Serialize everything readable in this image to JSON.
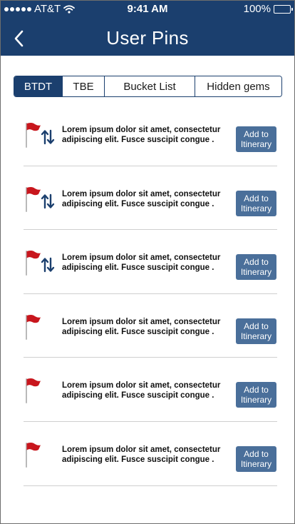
{
  "status_bar": {
    "carrier": "AT&T",
    "time": "9:41 AM",
    "battery": "100%",
    "battery_level": 1.0
  },
  "header": {
    "title": "User Pins",
    "back_icon": "chevron-left-icon"
  },
  "tabs": [
    {
      "label": "BTDT",
      "active": true
    },
    {
      "label": "TBE",
      "active": false
    },
    {
      "label": "Bucket List",
      "active": false
    },
    {
      "label": "Hidden gems",
      "active": false
    }
  ],
  "pins": [
    {
      "text": "Lorem ipsum dolor sit amet, consectetur adipiscing elit. Fusce suscipit congue .",
      "button": "Add to Itinerary",
      "has_sort": true,
      "flag_icon": "red-flag-icon",
      "sort_icon": "sort-arrows-icon"
    },
    {
      "text": "Lorem ipsum dolor sit amet, consectetur adipiscing elit. Fusce suscipit congue .",
      "button": "Add to Itinerary",
      "has_sort": true,
      "flag_icon": "red-flag-icon",
      "sort_icon": "sort-arrows-icon"
    },
    {
      "text": "Lorem ipsum dolor sit amet, consectetur adipiscing elit. Fusce suscipit congue .",
      "button": "Add to Itinerary",
      "has_sort": true,
      "flag_icon": "red-flag-icon",
      "sort_icon": "sort-arrows-icon"
    },
    {
      "text": "Lorem ipsum dolor sit amet, consectetur adipiscing elit. Fusce suscipit congue .",
      "button": "Add to Itinerary",
      "has_sort": false,
      "flag_icon": "red-flag-icon"
    },
    {
      "text": "Lorem ipsum dolor sit amet, consectetur adipiscing elit. Fusce suscipit congue .",
      "button": "Add to Itinerary",
      "has_sort": false,
      "flag_icon": "red-flag-icon"
    },
    {
      "text": "Lorem ipsum dolor sit amet, consectetur adipiscing elit. Fusce suscipit congue .",
      "button": "Add to Itinerary",
      "has_sort": false,
      "flag_icon": "red-flag-icon"
    }
  ],
  "colors": {
    "header_bg": "#1b3f6e",
    "tab_active_bg": "#1b3f6e",
    "button_bg": "#4a6f9a",
    "flag_red": "#c8161d",
    "sort_icon": "#1b3f6e"
  }
}
